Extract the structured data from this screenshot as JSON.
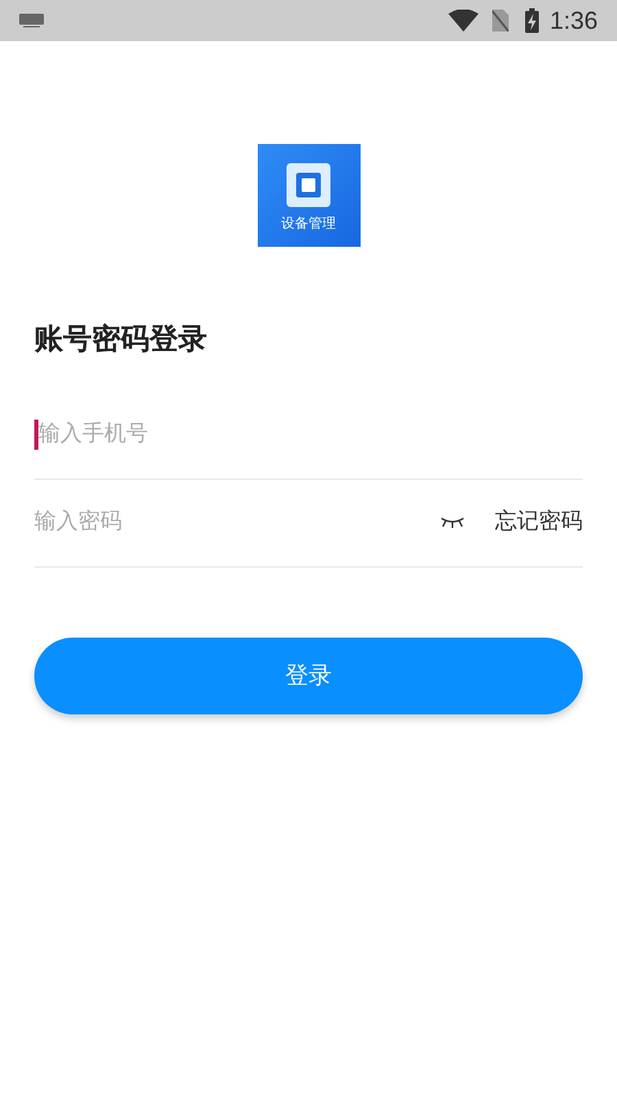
{
  "status_bar": {
    "time": "1:36"
  },
  "logo": {
    "caption": "设备管理"
  },
  "title": "账号密码登录",
  "phone_field": {
    "placeholder": "输入手机号",
    "focused": true
  },
  "password_field": {
    "placeholder": "输入密码",
    "password_visible": false
  },
  "forgot_link": "忘记密码",
  "login_button": "登录"
}
